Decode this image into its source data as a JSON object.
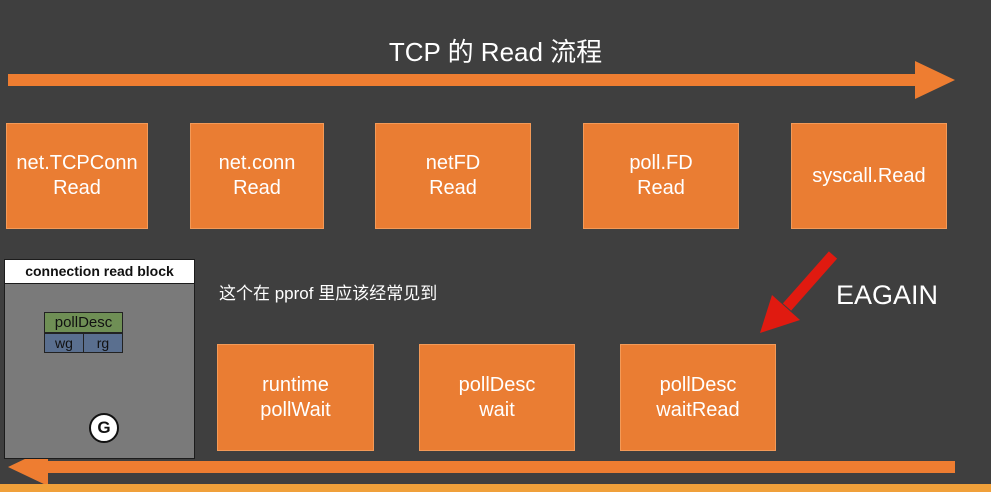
{
  "title": "TCP 的 Read 流程",
  "top_row": [
    {
      "line1": "net.TCPConn",
      "line2": "Read"
    },
    {
      "line1": "net.conn",
      "line2": "Read"
    },
    {
      "line1": "netFD",
      "line2": "Read"
    },
    {
      "line1": "poll.FD",
      "line2": "Read"
    },
    {
      "line1": "syscall.Read",
      "line2": ""
    }
  ],
  "bottom_row": [
    {
      "line1": "runtime",
      "line2": "pollWait"
    },
    {
      "line1": "pollDesc",
      "line2": "wait"
    },
    {
      "line1": "pollDesc",
      "line2": "waitRead"
    }
  ],
  "note": "这个在 pprof 里应该经常见到",
  "eagain_label": "EAGAIN",
  "panel": {
    "title": "connection read block",
    "struct_name": "pollDesc",
    "fields": [
      "wg",
      "rg"
    ],
    "goroutine": "G"
  },
  "colors": {
    "background": "#3f3f3f",
    "box": "#ea7d33",
    "arrow": "#ee7d31",
    "red_arrow": "#e01a10"
  }
}
